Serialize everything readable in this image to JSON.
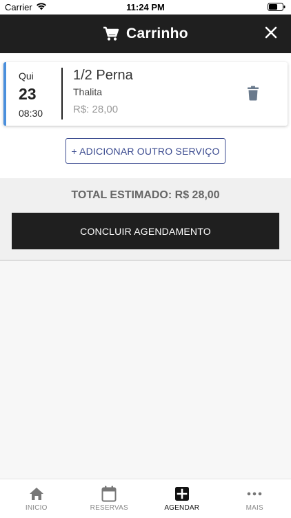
{
  "status_bar": {
    "carrier": "Carrier",
    "time": "11:24 PM"
  },
  "header": {
    "title": "Carrinho",
    "icon": "cart-icon",
    "close_icon": "close-icon",
    "background": "#1f1f1f"
  },
  "cart": {
    "items": [
      {
        "weekday": "Qui",
        "day": "23",
        "time": "08:30",
        "service": "1/2 Perna",
        "professional": "Thalita",
        "price": "R$: 28,00",
        "accent_color": "#4a8fdc",
        "delete_icon": "trash-icon"
      }
    ],
    "add_service_label": "+ ADICIONAR OUTRO SERVIÇO"
  },
  "summary": {
    "total_label": "TOTAL ESTIMADO: R$ 28,00",
    "confirm_label": "CONCLUIR AGENDAMENTO"
  },
  "bottom_nav": {
    "items": [
      {
        "label": "INICIO",
        "icon": "home-icon",
        "active": false
      },
      {
        "label": "RESERVAS",
        "icon": "calendar-icon",
        "active": false
      },
      {
        "label": "AGENDAR",
        "icon": "add-box-icon",
        "active": true
      },
      {
        "label": "MAIS",
        "icon": "more-icon",
        "active": false
      }
    ]
  }
}
